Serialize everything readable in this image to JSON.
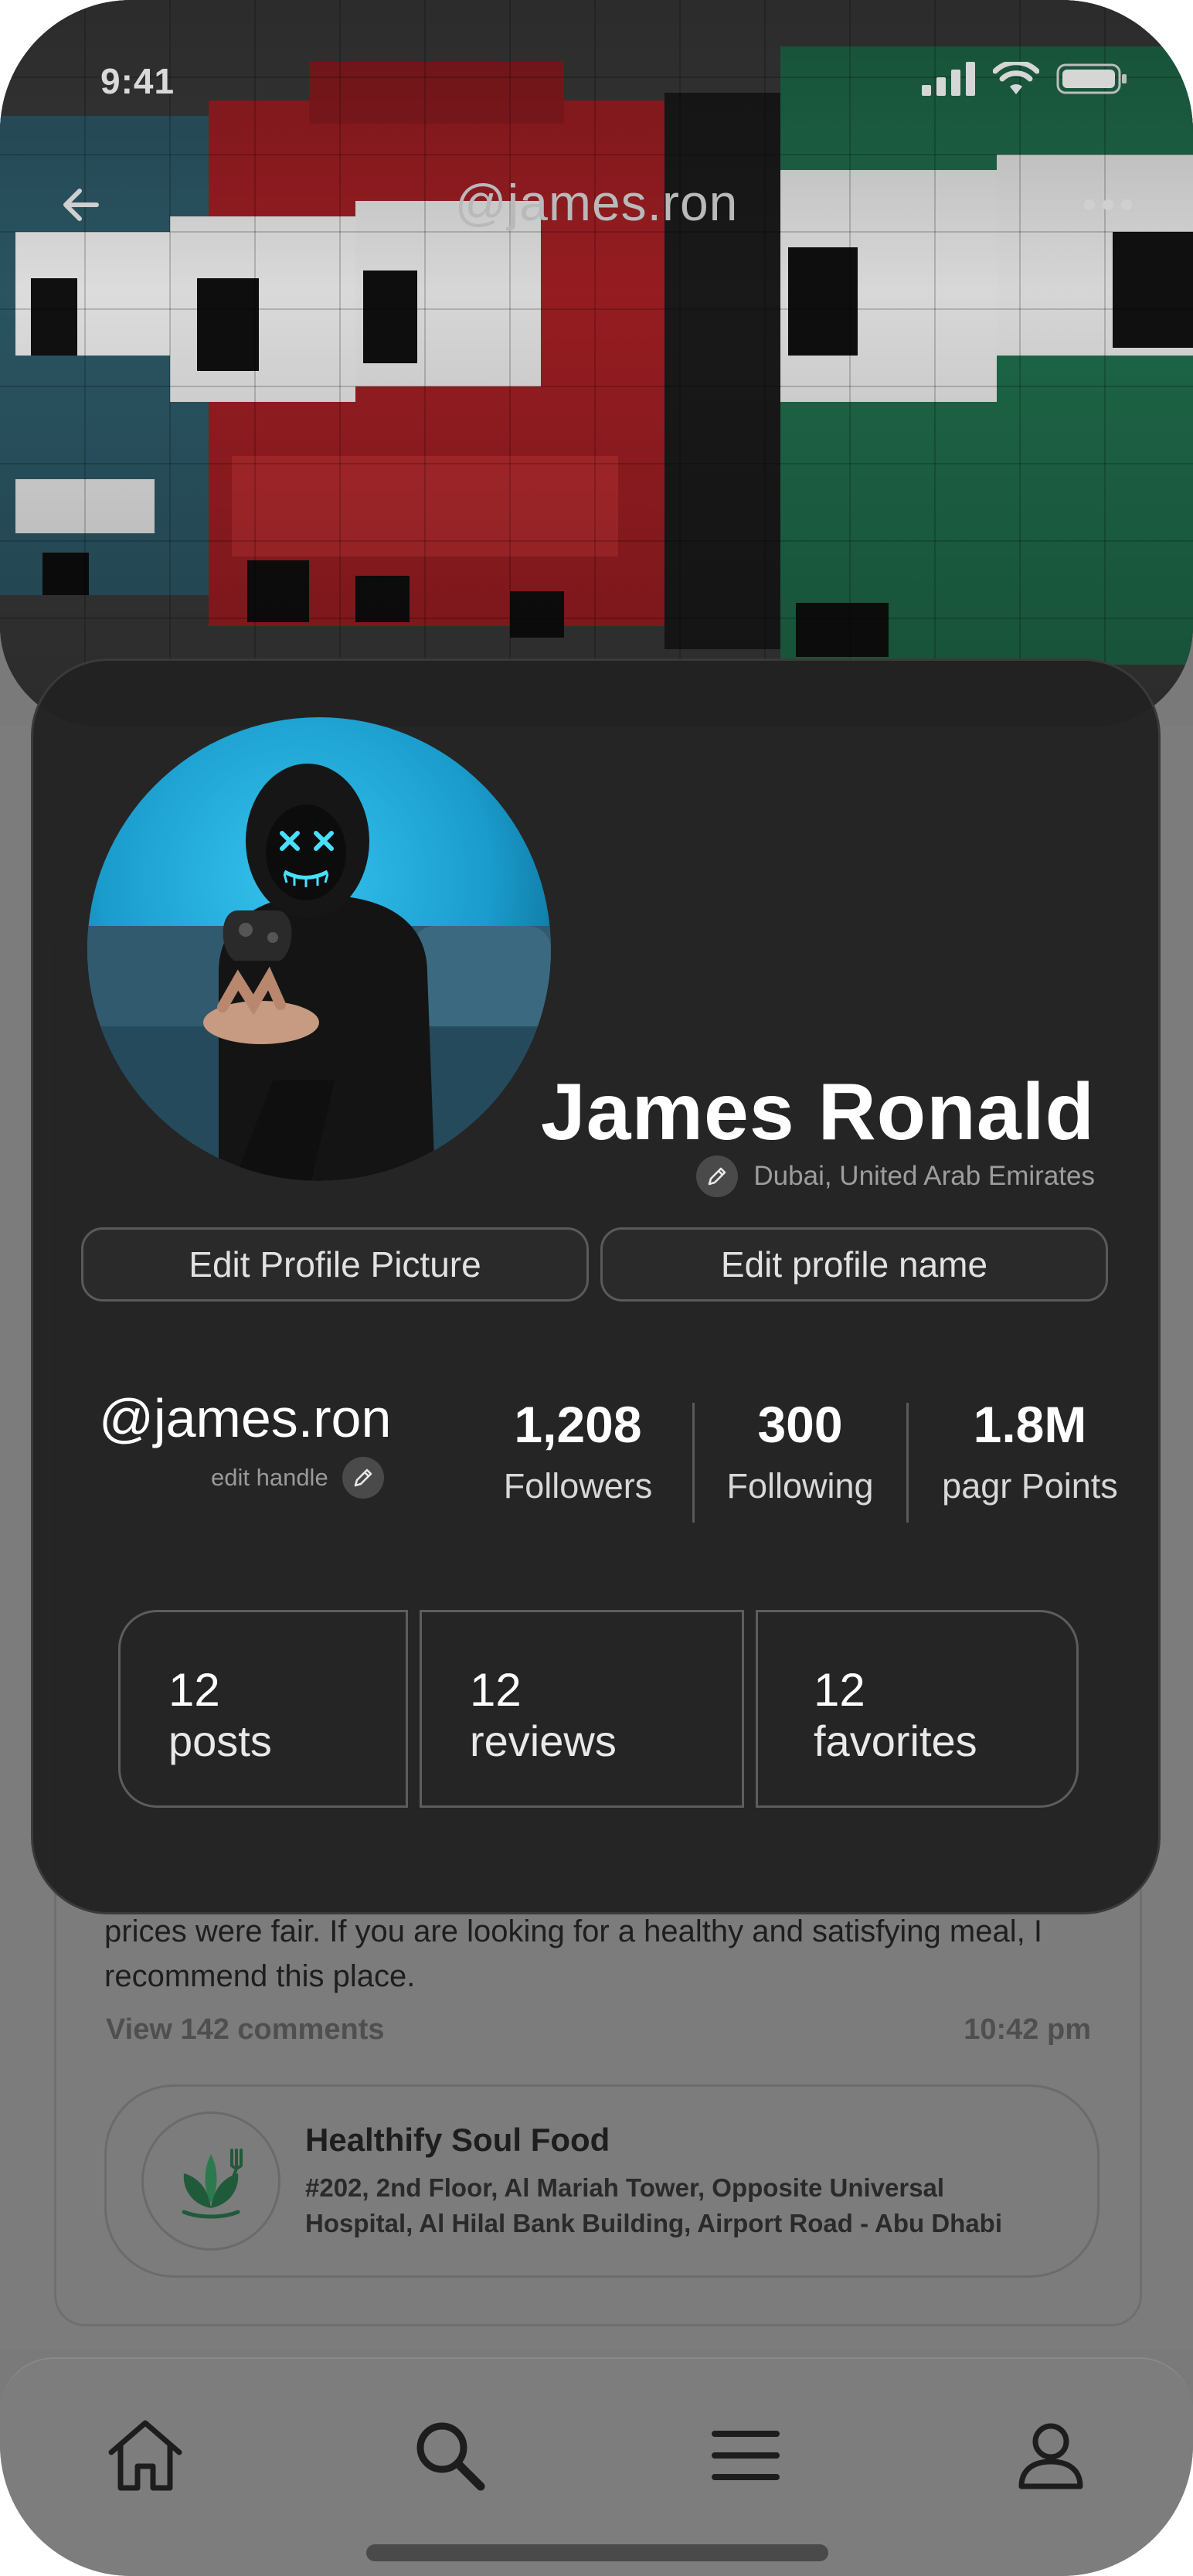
{
  "status_bar": {
    "time": "9:41"
  },
  "header": {
    "title": "@james.ron"
  },
  "profile": {
    "name": "James Ronald",
    "location": "Dubai, United Arab Emirates",
    "edit_picture_label": "Edit Profile Picture",
    "edit_name_label": "Edit profile name",
    "handle": "@james.ron",
    "edit_handle_label": "edit handle",
    "stats": [
      {
        "value": "1,208",
        "label": "Followers"
      },
      {
        "value": "300",
        "label": "Following"
      },
      {
        "value": "1.8M",
        "label": "pagr Points"
      }
    ],
    "counts": [
      {
        "value": "12",
        "label": "posts"
      },
      {
        "value": "12",
        "label": "reviews"
      },
      {
        "value": "12",
        "label": "favorites"
      }
    ]
  },
  "feed": {
    "review_text": "prices were fair. If you are looking for a healthy and satisfying meal, I recommend this place.",
    "comments_link": "View 142 comments",
    "time": "10:42 pm",
    "venue": {
      "name": "Healthify Soul Food",
      "address": "#202, 2nd Floor, Al Mariah Tower, Opposite Universal Hospital, Al Hilal Bank Building, Airport Road - Abu Dhabi"
    }
  },
  "tab_bar": {
    "tabs": [
      "home-icon",
      "search-icon",
      "menu-icon",
      "profile-icon"
    ]
  },
  "colors": {
    "card": "#222222",
    "accent_blue": "#1fa5d6",
    "venue_green": "#1f5a3a"
  }
}
